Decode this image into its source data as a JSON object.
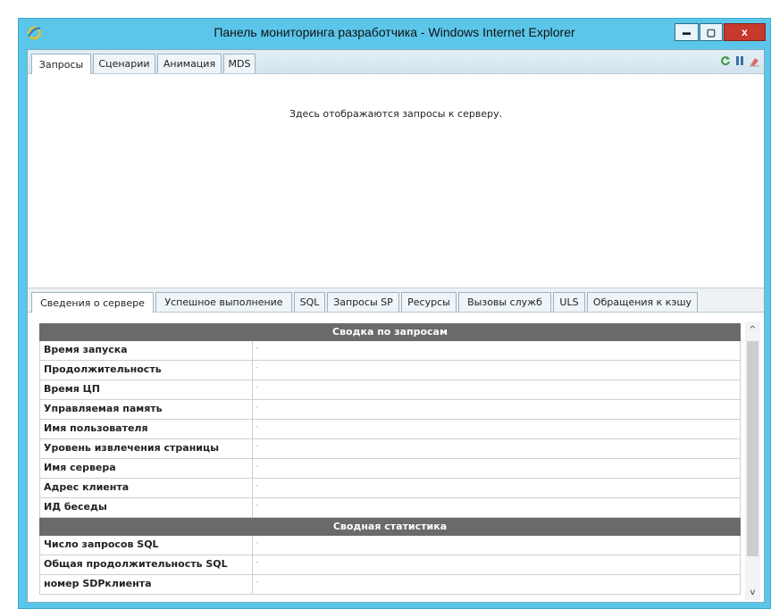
{
  "window": {
    "title": "Панель мониторинга разработчика - Windows Internet Explorer",
    "minimize_glyph": "▬",
    "maximize_glyph": "▢",
    "close_glyph": "x"
  },
  "top_tabs": [
    "Запросы",
    "Сценарии",
    "Анимация",
    "MDS"
  ],
  "toolbar_icons": [
    "refresh-icon",
    "pause-icon",
    "clear-icon"
  ],
  "message": "Здесь отображаются запросы к серверу.",
  "bottom_tabs": [
    "Сведения о сервере",
    "Успешное выполнение",
    "SQL",
    "Запросы SP",
    "Ресурсы",
    "Вызовы служб",
    "ULS",
    "Обращения к кэшу"
  ],
  "grid": {
    "summary_header": "Сводка по запросам",
    "summary_rows": [
      {
        "label": "Время запуска",
        "value": "-"
      },
      {
        "label": "Продолжительность",
        "value": "-"
      },
      {
        "label": "Время ЦП",
        "value": "-"
      },
      {
        "label": "Управляемая память",
        "value": "-"
      },
      {
        "label": "Имя пользователя",
        "value": "-"
      },
      {
        "label": "Уровень извлечения страницы",
        "value": "-"
      },
      {
        "label": "Имя сервера",
        "value": "-"
      },
      {
        "label": "Адрес клиента",
        "value": "-"
      },
      {
        "label": "ИД беседы",
        "value": "-"
      }
    ],
    "stats_header": "Сводная статистика",
    "stats_rows": [
      {
        "label": "Число запросов SQL",
        "value": "-"
      },
      {
        "label": "Общая продолжительность SQL",
        "value": "-"
      },
      {
        "label": "номер SDPклиента",
        "value": "-"
      }
    ]
  },
  "scrollbar": {
    "up": "^",
    "down": "v"
  },
  "colors": {
    "frame": "#5bc6ea",
    "close": "#c7392d",
    "section_header": "#6a6a6a"
  }
}
